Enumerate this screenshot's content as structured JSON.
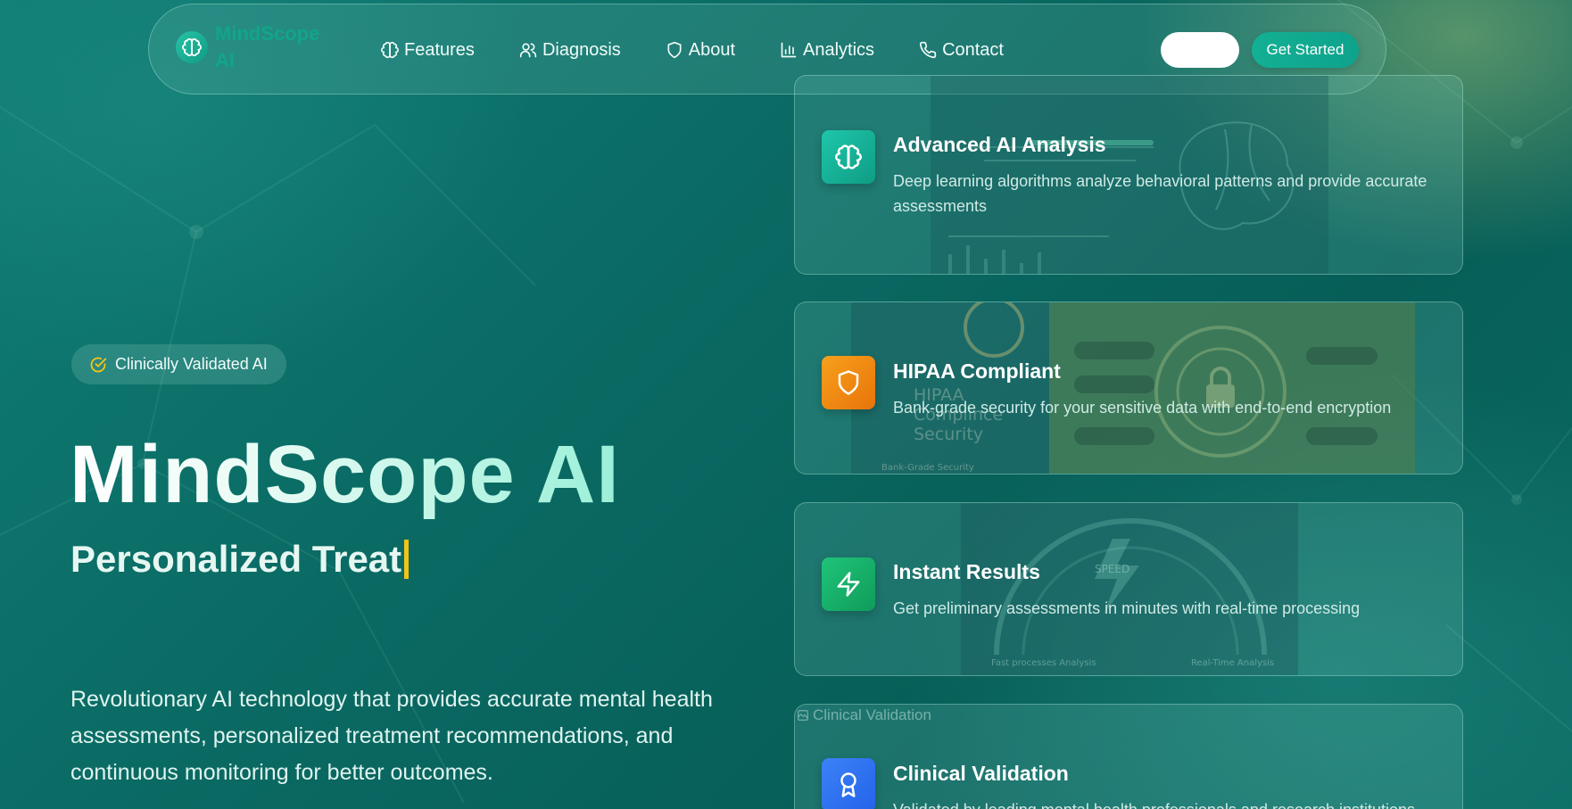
{
  "nav": {
    "brand": "MindScope AI",
    "links": [
      {
        "label": "Features",
        "icon": "brain-icon"
      },
      {
        "label": "Diagnosis",
        "icon": "users-icon"
      },
      {
        "label": "About",
        "icon": "shield-icon"
      },
      {
        "label": "Analytics",
        "icon": "bar-chart-icon"
      },
      {
        "label": "Contact",
        "icon": "phone-icon"
      }
    ],
    "cta": "Get Started"
  },
  "hero": {
    "badge": "Clinically Validated AI",
    "title": "MindScope AI",
    "subtitle": "Personalized Treat",
    "description": "Revolutionary AI technology that provides accurate mental health assessments, personalized treatment recommendations, and continuous monitoring for better outcomes."
  },
  "features": [
    {
      "title": "Advanced AI Analysis",
      "text": "Deep learning algorithms analyze behavioral patterns and provide accurate assessments",
      "icon": "brain-icon",
      "color": "#14b8a0"
    },
    {
      "title": "HIPAA Compliant",
      "text": "Bank-grade security for your sensitive data with end-to-end encryption",
      "icon": "shield-icon",
      "color": "#f08a0c",
      "art_text": "HIPAA Complince Security",
      "art_caption": "Bank-Grade Security"
    },
    {
      "title": "Instant Results",
      "text": "Get preliminary assessments in minutes with real-time processing",
      "icon": "lightning-icon",
      "color": "#16b06a",
      "art_text": "SPEED",
      "art_caption_left": "Fast processes Analysis",
      "art_caption_right": "Real-Time Analysis"
    },
    {
      "title": "Clinical Validation",
      "text": "Validated by leading mental health professionals and research institutions",
      "icon": "award-icon",
      "color": "#2f6ff0",
      "img_alt": "Clinical Validation"
    }
  ],
  "colors": {
    "accent": "#12b094",
    "cursor": "#f2c417"
  }
}
